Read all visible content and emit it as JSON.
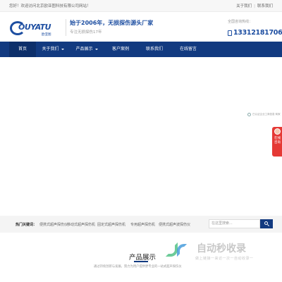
{
  "topbar": {
    "welcome": "您好！欢迎访问北京欧亚图科技有限公司网站！",
    "links": [
      "关于我们",
      "联系我们"
    ]
  },
  "header": {
    "logo_text": "OUYATU",
    "logo_sub": "欧亚图",
    "slogan": "始于2006年，无损探伤源头厂家",
    "subslogan": "专注无损探伤17年",
    "hotline_label": "全国咨询热线：",
    "hotline_phone": "13312181706"
  },
  "nav": {
    "items": [
      {
        "label": "首页",
        "active": true
      },
      {
        "label": "关于我们",
        "dropdown": true
      },
      {
        "label": "产品展示",
        "dropdown": true
      },
      {
        "label": "客户案例"
      },
      {
        "label": "联系我们"
      },
      {
        "label": "在线留言"
      }
    ]
  },
  "banner": {
    "cert_text": "已认证企业工商信息·商家",
    "slides": 4,
    "active_slide": 1
  },
  "float_service": {
    "label": "在线咨询"
  },
  "search": {
    "hot_label": "热门关键词：",
    "keywords": [
      "便携式超声探伤仪",
      "移动式超声探伤机",
      "固定式超声探伤机",
      "专用超声探伤机",
      "便携式超声波探伤仪"
    ],
    "placeholder": "在这里搜索..."
  },
  "products": {
    "title": "产品展示",
    "description": "通过持续创新与发展，努力为用户提供更专业的一站式超声探伤仪"
  },
  "watermark": {
    "title": "自动秒收录",
    "subtitle": "做上链接一来访一次一自动收录一"
  }
}
